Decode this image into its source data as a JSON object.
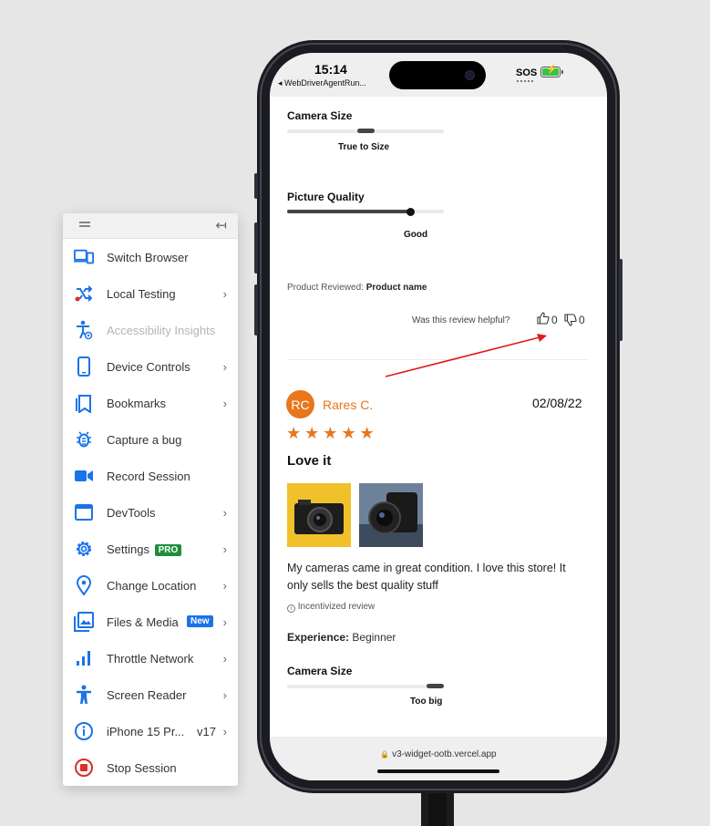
{
  "sidebar": {
    "items": [
      {
        "label": "Switch Browser",
        "icon": "switch-browser-icon",
        "chevron": ""
      },
      {
        "label": "Local Testing",
        "icon": "local-testing-icon",
        "chevron": "›"
      },
      {
        "label": "Accessibility Insights",
        "icon": "accessibility-insights-icon",
        "chevron": ""
      },
      {
        "label": "Device Controls",
        "icon": "device-controls-icon",
        "chevron": "›"
      },
      {
        "label": "Bookmarks",
        "icon": "bookmarks-icon",
        "chevron": "›"
      },
      {
        "label": "Capture a bug",
        "icon": "bug-icon",
        "chevron": ""
      },
      {
        "label": "Record Session",
        "icon": "record-session-icon",
        "chevron": ""
      },
      {
        "label": "DevTools",
        "icon": "devtools-icon",
        "chevron": "›"
      },
      {
        "label": "Settings",
        "icon": "settings-icon",
        "chevron": "›",
        "badge": "PRO"
      },
      {
        "label": "Change Location",
        "icon": "location-icon",
        "chevron": "›"
      },
      {
        "label": "Files & Media",
        "icon": "files-media-icon",
        "chevron": "›",
        "badge": "New"
      },
      {
        "label": "Throttle Network",
        "icon": "throttle-network-icon",
        "chevron": "›"
      },
      {
        "label": "Screen Reader",
        "icon": "screen-reader-icon",
        "chevron": "›"
      },
      {
        "label": "iPhone 15 Pr...",
        "icon": "info-icon",
        "chevron": "›",
        "version": "v17"
      },
      {
        "label": "Stop Session",
        "icon": "stop-session-icon",
        "chevron": ""
      }
    ],
    "collapse_glyph": "↤",
    "accent": "#1a73e8",
    "stop_color": "#d93025"
  },
  "phone": {
    "time": "15:14",
    "back_app": "◂ WebDriverAgentRun...",
    "sos": "SOS",
    "url": "v3-widget-ootb.vercel.app",
    "lock_glyph": "🔒"
  },
  "review_top": {
    "camera_size_label": "Camera Size",
    "camera_size_value": "True to Size",
    "camera_size_level": 0.5,
    "picture_quality_label": "Picture Quality",
    "picture_quality_value": "Good",
    "picture_quality_level": 0.8,
    "product_reviewed_prefix": "Product Reviewed:",
    "product_name": "Product name",
    "helpful_question": "Was this review helpful?",
    "helpful_yes_count": "0",
    "helpful_no_count": "0"
  },
  "review": {
    "initials": "RC",
    "name": "Rares C.",
    "date": "02/08/22",
    "rating": 5,
    "stars": "★★★★★",
    "title": "Love it",
    "body": "My cameras came in great condition. I love this store! It only sells the best quality stuff",
    "incentivized": "Incentivized review",
    "experience_label": "Experience:",
    "experience_value": "Beginner",
    "camera_size_label": "Camera Size",
    "camera_size_value": "Too big",
    "camera_size_level": 0.95
  },
  "colors": {
    "accent": "#e8761d",
    "annotation": "#e01b1b"
  }
}
